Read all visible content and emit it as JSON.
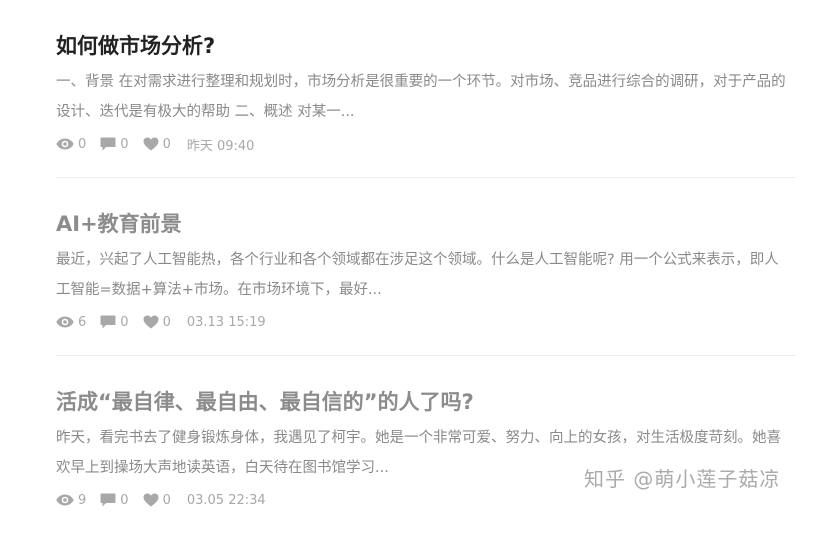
{
  "articles": [
    {
      "title": "如何做市场分析?",
      "summary": "一、背景 在对需求进行整理和规划时，市场分析是很重要的一个环节。对市场、竞品进行综合的调研，对于产品的设计、迭代是有极大的帮助 二、概述 对某一...",
      "views": "0",
      "comments": "0",
      "likes": "0",
      "time": "昨天 09:40"
    },
    {
      "title": "AI+教育前景",
      "summary": "最近，兴起了人工智能热，各个行业和各个领域都在涉足这个领域。什么是人工智能呢? 用一个公式来表示，即人工智能=数据+算法+市场。在市场环境下，最好...",
      "views": "6",
      "comments": "0",
      "likes": "0",
      "time": "03.13 15:19"
    },
    {
      "title": "活成“最自律、最自由、最自信的”的人了吗?",
      "summary": "昨天，看完书去了健身锻炼身体，我遇见了柯宇。她是一个非常可爱、努力、向上的女孩，对生活极度苛刻。她喜欢早上到操场大声地读英语，白天待在图书馆学习...",
      "views": "9",
      "comments": "0",
      "likes": "0",
      "time": "03.05 22:34"
    }
  ],
  "icons": {
    "views": "eye-icon",
    "comments": "comment-icon",
    "likes": "heart-icon"
  },
  "colors": {
    "title": "#222222",
    "title_dim": "#8c8c8c",
    "summary": "#8a8a8a",
    "meta": "#a8a8a8",
    "divider": "#ececec"
  },
  "watermark": "知乎 @萌小莲子菇凉"
}
